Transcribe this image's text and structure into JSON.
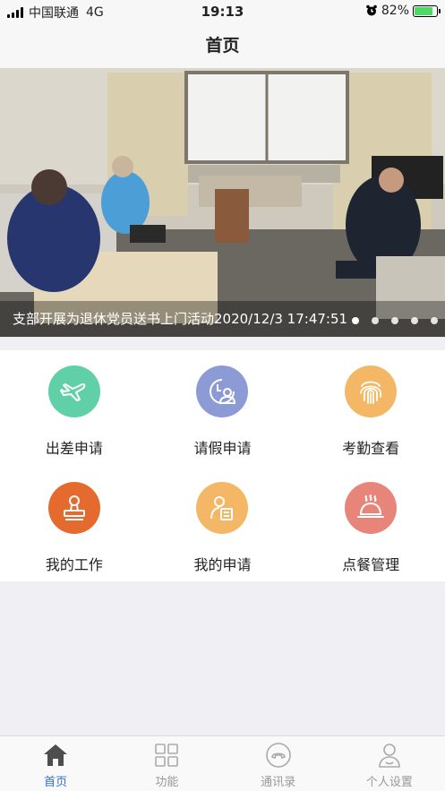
{
  "status_bar": {
    "carrier": "中国联通",
    "network": "4G",
    "time": "19:13",
    "battery": "82%",
    "battery_level": 0.82
  },
  "nav": {
    "title": "首页"
  },
  "banner": {
    "caption": "支部开展为退休党员送书上门活动2020/12/3 17:47:51",
    "dot_count": 5,
    "active_dot": 0
  },
  "features": [
    {
      "label": "出差申请",
      "icon": "airplane-icon",
      "color": "#5fd0a8"
    },
    {
      "label": "请假申请",
      "icon": "leave-person-icon",
      "color": "#8c9bd6"
    },
    {
      "label": "考勤查看",
      "icon": "fingerprint-icon",
      "color": "#f3b766"
    },
    {
      "label": "我的工作",
      "icon": "stamp-icon",
      "color": "#e56a2e"
    },
    {
      "label": "我的申请",
      "icon": "application-form-icon",
      "color": "#f3b766"
    },
    {
      "label": "点餐管理",
      "icon": "food-cloche-icon",
      "color": "#e7857b"
    }
  ],
  "tabs": [
    {
      "label": "首页",
      "icon": "home-icon",
      "active": true
    },
    {
      "label": "功能",
      "icon": "grid-icon",
      "active": false
    },
    {
      "label": "通讯录",
      "icon": "phone-icon",
      "active": false
    },
    {
      "label": "个人设置",
      "icon": "user-icon",
      "active": false
    }
  ],
  "colors": {
    "tab_active": "#2f6fd8",
    "tab_inactive": "#999999"
  }
}
